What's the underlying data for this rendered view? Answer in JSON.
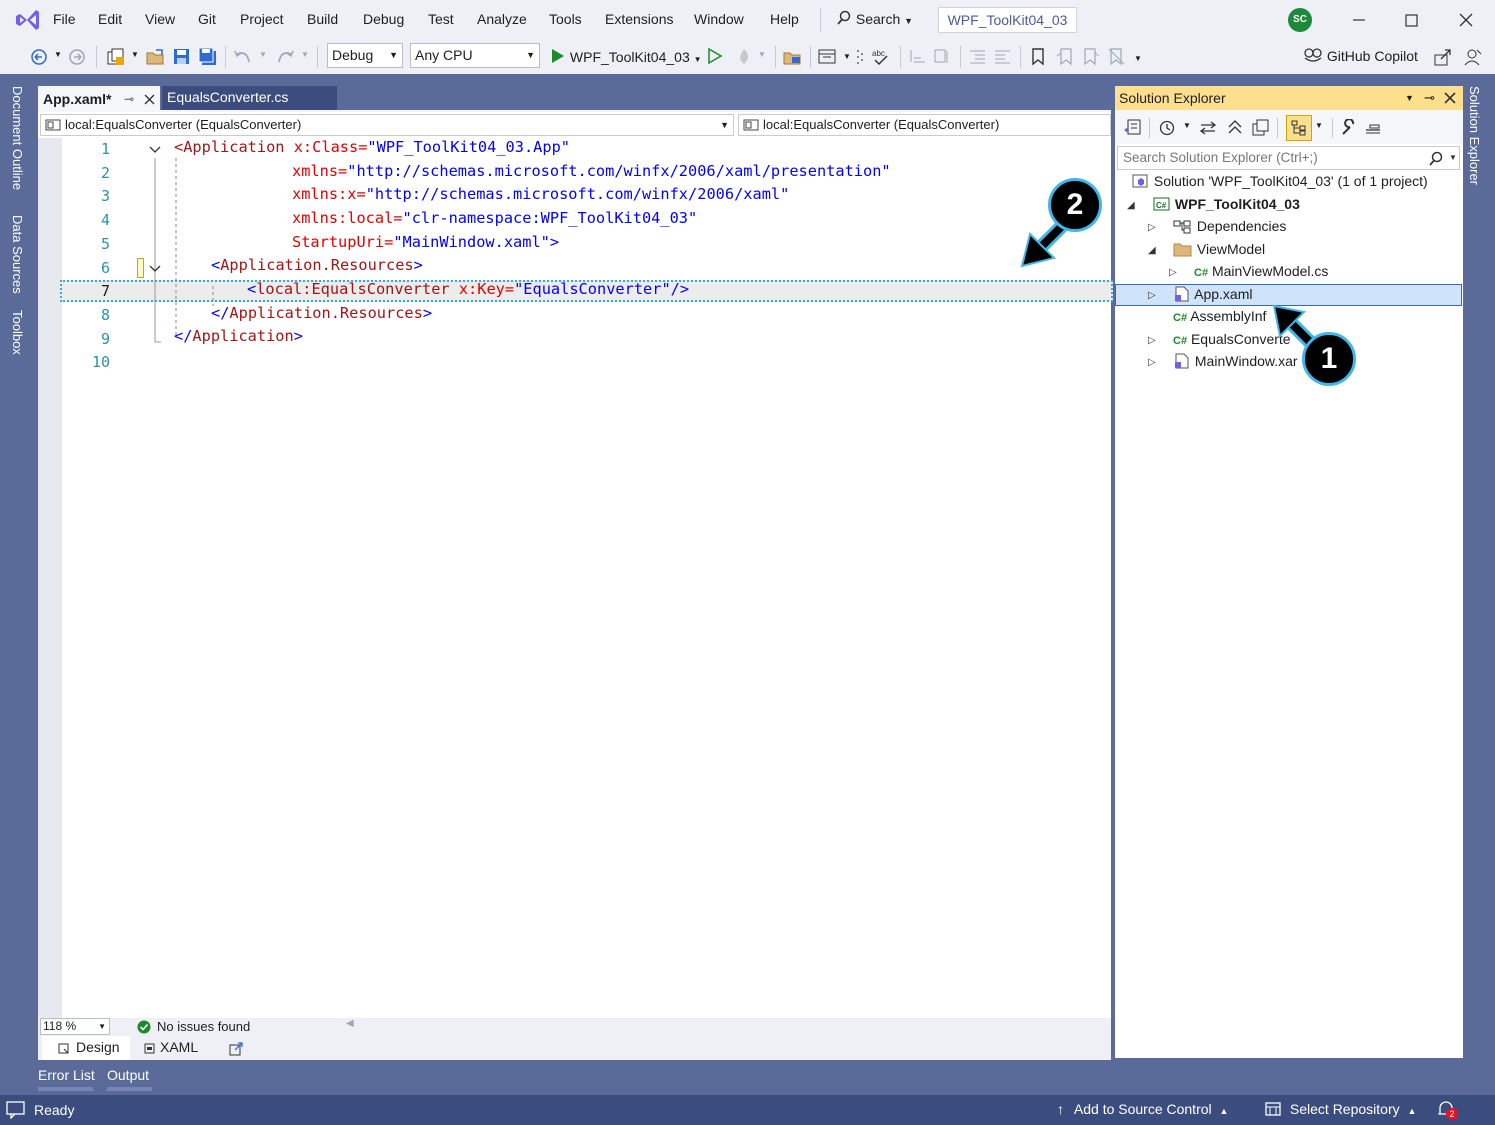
{
  "menu": [
    "File",
    "Edit",
    "View",
    "Git",
    "Project",
    "Build",
    "Debug",
    "Test",
    "Analyze",
    "Tools",
    "Extensions",
    "Window",
    "Help"
  ],
  "search_label": "Search",
  "solution_title": "WPF_ToolKit04_03",
  "avatar_initials": "SC",
  "toolbar": {
    "config": "Debug",
    "platform": "Any CPU",
    "run_target": "WPF_ToolKit04_03",
    "copilot": "GitHub Copilot"
  },
  "left_rail": [
    "Document Outline",
    "Data Sources",
    "Toolbox"
  ],
  "right_rail": "Solution Explorer",
  "tabs": [
    {
      "label": "App.xaml*",
      "active": true
    },
    {
      "label": "EqualsConverter.cs",
      "active": false
    }
  ],
  "nav": {
    "left": "local:EqualsConverter (EqualsConverter)",
    "right": "local:EqualsConverter (EqualsConverter)"
  },
  "code": {
    "line_numbers": [
      "1",
      "2",
      "3",
      "4",
      "5",
      "6",
      "7",
      "8",
      "9",
      "10"
    ],
    "l1_tag": "<Application",
    "l1_attr": " x:Class=",
    "l1_val": "\"WPF_ToolKit04_03.App\"",
    "l2_attr": "xmlns=",
    "l2_val": "\"http://schemas.microsoft.com/winfx/2006/xaml/presentation\"",
    "l3_attr": "xmlns:x=",
    "l3_val": "\"http://schemas.microsoft.com/winfx/2006/xaml\"",
    "l4_attr": "xmlns:local=",
    "l4_val": "\"clr-namespace:WPF_ToolKit04_03\"",
    "l5_attr": "StartupUri=",
    "l5_val": "\"MainWindow.xaml\"",
    "l5_end": ">",
    "l6_open": "<",
    "l6_tag": "Application.Resources",
    "l6_close": ">",
    "l7_open": "<",
    "l7_tag": "local:EqualsConverter",
    "l7_attr": " x:Key=",
    "l7_val": "\"EqualsConverter\"",
    "l7_close": "/>",
    "l8_open": "</",
    "l8_tag": "Application.Resources",
    "l8_close": ">",
    "l9_open": "</",
    "l9_tag": "Application",
    "l9_close": ">"
  },
  "editor_status": {
    "zoom": "118 %",
    "issues": "No issues found",
    "design_tab": "Design",
    "xaml_tab": "XAML"
  },
  "solution_explorer": {
    "title": "Solution Explorer",
    "search_placeholder": "Search Solution Explorer (Ctrl+;)",
    "solution": "Solution 'WPF_ToolKit04_03' (1 of 1 project)",
    "project": "WPF_ToolKit04_03",
    "items": {
      "dependencies": "Dependencies",
      "viewmodel": "ViewModel",
      "mainviewmodel": "MainViewModel.cs",
      "app": "App.xaml",
      "assembly": "AssemblyInf",
      "equals": "EqualsConverte",
      "mainwindow": "MainWindow.xar"
    }
  },
  "panels": [
    "Error List",
    "Output"
  ],
  "status": {
    "ready": "Ready",
    "source_control": "Add to Source Control",
    "repository": "Select Repository",
    "notifications": "2"
  },
  "callouts": [
    "1",
    "2"
  ],
  "colors": {
    "accent": "#5a6a99",
    "dark_accent": "#3b4c7f",
    "highlight": "#fddf8e",
    "callout_border": "#3fb7e8"
  }
}
